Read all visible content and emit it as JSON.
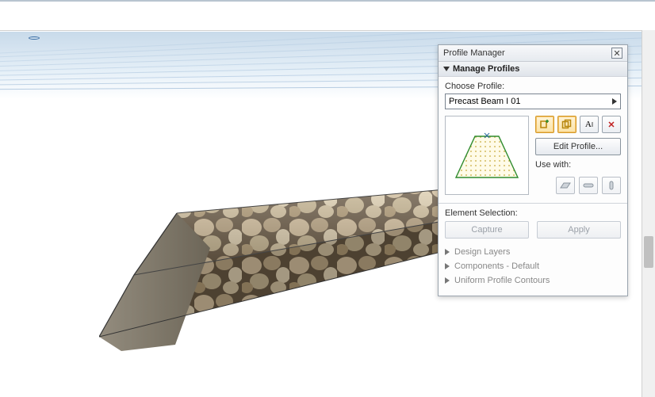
{
  "panel": {
    "title": "Profile Manager",
    "section_manage": "Manage Profiles",
    "choose_label": "Choose Profile:",
    "selected_profile": "Precast Beam I 01",
    "edit_button": "Edit Profile...",
    "use_with_label": "Use with:",
    "element_selection_label": "Element Selection:",
    "capture_button": "Capture",
    "apply_button": "Apply",
    "sub_design_layers": "Design Layers",
    "sub_components": "Components - Default",
    "sub_contours": "Uniform Profile Contours"
  },
  "icons": {
    "new": "new-profile-icon",
    "duplicate": "duplicate-profile-icon",
    "rename": "rename-icon",
    "delete": "delete-icon",
    "use_wall": "wall-icon",
    "use_beam": "beam-icon",
    "use_column": "column-icon"
  }
}
